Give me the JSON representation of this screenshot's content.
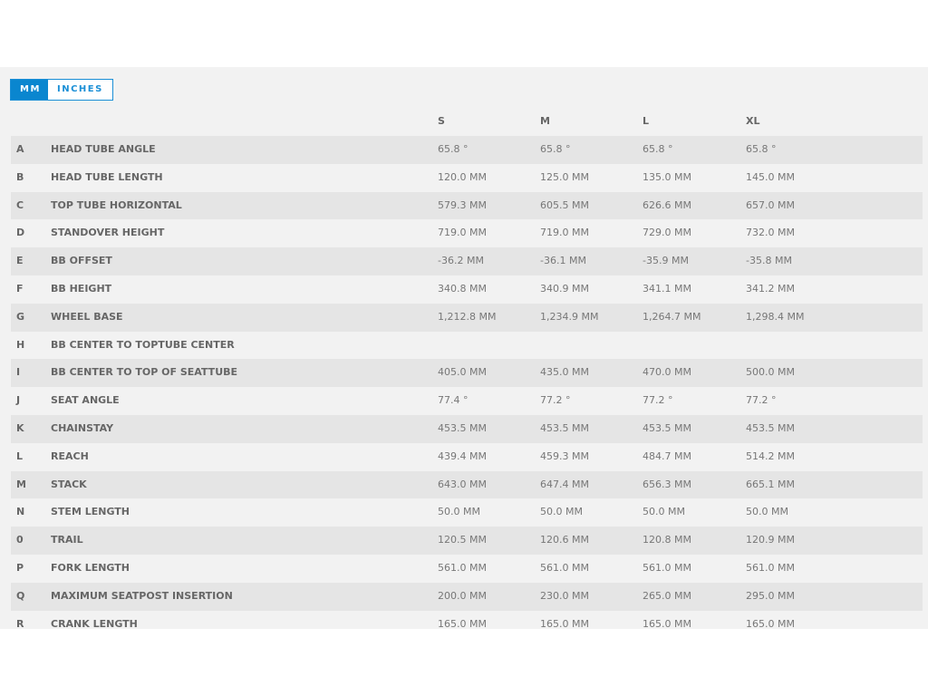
{
  "units": {
    "mm": "MM",
    "inches": "INCHES",
    "selected": "mm"
  },
  "sizes": [
    "S",
    "M",
    "L",
    "XL"
  ],
  "rows": [
    {
      "letter": "A",
      "name": "HEAD TUBE ANGLE",
      "values": [
        "65.8 °",
        "65.8 °",
        "65.8 °",
        "65.8 °"
      ]
    },
    {
      "letter": "B",
      "name": "HEAD TUBE LENGTH",
      "values": [
        "120.0 MM",
        "125.0 MM",
        "135.0 MM",
        "145.0 MM"
      ]
    },
    {
      "letter": "C",
      "name": "TOP TUBE HORIZONTAL",
      "values": [
        "579.3 MM",
        "605.5 MM",
        "626.6 MM",
        "657.0 MM"
      ]
    },
    {
      "letter": "D",
      "name": "STANDOVER HEIGHT",
      "values": [
        "719.0 MM",
        "719.0 MM",
        "729.0 MM",
        "732.0 MM"
      ]
    },
    {
      "letter": "E",
      "name": "BB OFFSET",
      "values": [
        "-36.2 MM",
        "-36.1 MM",
        "-35.9 MM",
        "-35.8 MM"
      ]
    },
    {
      "letter": "F",
      "name": "BB HEIGHT",
      "values": [
        "340.8 MM",
        "340.9 MM",
        "341.1 MM",
        "341.2 MM"
      ]
    },
    {
      "letter": "G",
      "name": "WHEEL BASE",
      "values": [
        "1,212.8 MM",
        "1,234.9 MM",
        "1,264.7 MM",
        "1,298.4 MM"
      ]
    },
    {
      "letter": "H",
      "name": "BB CENTER TO TOPTUBE CENTER",
      "values": [
        "",
        "",
        "",
        ""
      ]
    },
    {
      "letter": "I",
      "name": "BB CENTER TO TOP OF SEATTUBE",
      "values": [
        "405.0 MM",
        "435.0 MM",
        "470.0 MM",
        "500.0 MM"
      ]
    },
    {
      "letter": "J",
      "name": "SEAT ANGLE",
      "values": [
        "77.4 °",
        "77.2 °",
        "77.2 °",
        "77.2 °"
      ]
    },
    {
      "letter": "K",
      "name": "CHAINSTAY",
      "values": [
        "453.5 MM",
        "453.5 MM",
        "453.5 MM",
        "453.5 MM"
      ]
    },
    {
      "letter": "L",
      "name": "REACH",
      "values": [
        "439.4 MM",
        "459.3 MM",
        "484.7 MM",
        "514.2 MM"
      ]
    },
    {
      "letter": "M",
      "name": "STACK",
      "values": [
        "643.0 MM",
        "647.4 MM",
        "656.3 MM",
        "665.1 MM"
      ]
    },
    {
      "letter": "N",
      "name": "STEM LENGTH",
      "values": [
        "50.0 MM",
        "50.0 MM",
        "50.0 MM",
        "50.0 MM"
      ]
    },
    {
      "letter": "0",
      "name": "TRAIL",
      "values": [
        "120.5 MM",
        "120.6 MM",
        "120.8 MM",
        "120.9 MM"
      ]
    },
    {
      "letter": "P",
      "name": "FORK LENGTH",
      "values": [
        "561.0 MM",
        "561.0 MM",
        "561.0 MM",
        "561.0 MM"
      ]
    },
    {
      "letter": "Q",
      "name": "MAXIMUM SEATPOST INSERTION",
      "values": [
        "200.0 MM",
        "230.0 MM",
        "265.0 MM",
        "295.0 MM"
      ]
    },
    {
      "letter": "R",
      "name": "CRANK LENGTH",
      "values": [
        "165.0 MM",
        "165.0 MM",
        "165.0 MM",
        "165.0 MM"
      ]
    }
  ]
}
